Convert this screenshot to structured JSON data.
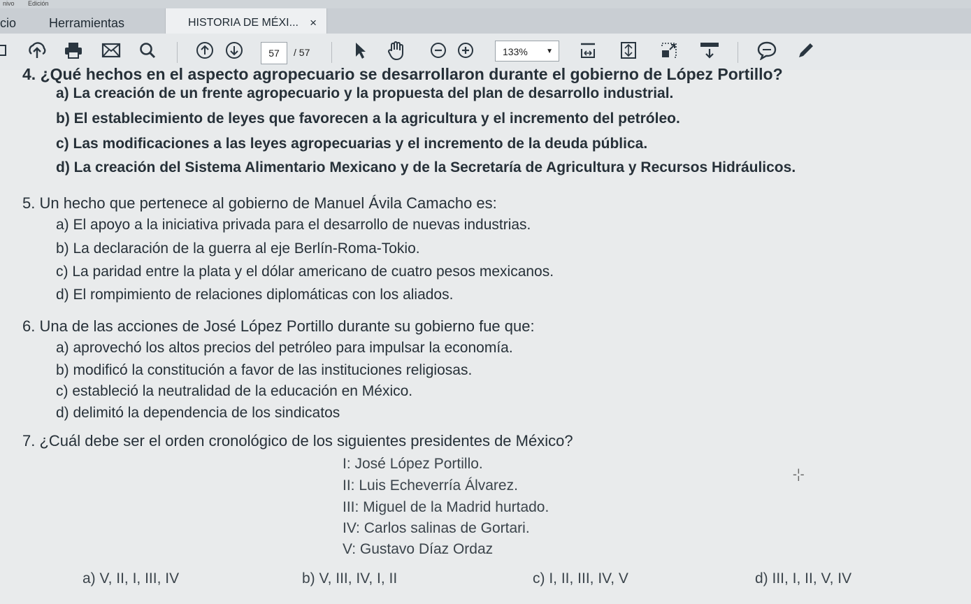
{
  "menubar": {
    "left": "nivo",
    "right": "Edición"
  },
  "tabs": {
    "inicio": "icio",
    "herramientas": "Herramientas",
    "document": "HISTORIA DE MÉXI...",
    "close": "×"
  },
  "toolbar": {
    "page_current": "57",
    "page_total": "/ 57",
    "zoom": "133%",
    "icons": [
      "sidebar-icon",
      "upload-icon",
      "print-icon",
      "email-icon",
      "search-icon",
      "page-up-icon",
      "page-down-icon",
      "select-arrow-icon",
      "hand-icon",
      "zoom-out-icon",
      "zoom-in-icon",
      "fit-width-icon",
      "fit-page-icon",
      "fullscreen-icon",
      "scroll-icon",
      "comment-icon",
      "pen-icon"
    ]
  },
  "questions": {
    "q4": {
      "stem": "4.  ¿Qué hechos en el aspecto agropecuario se desarrollaron durante el gobierno de López Portillo?",
      "a": "a) La creación de un frente agropecuario y la propuesta del plan de desarrollo industrial.",
      "b": "b) El establecimiento de leyes que favorecen a la agricultura y el incremento del petróleo.",
      "c": "c) Las modificaciones a las leyes agropecuarias y el incremento de la deuda pública.",
      "d": "d) La creación del Sistema Alimentario Mexicano y de la Secretaría de Agricultura y Recursos Hidráulicos."
    },
    "q5": {
      "stem": "5.  Un hecho que pertenece al gobierno de Manuel Ávila Camacho es:",
      "a": "a) El apoyo a la iniciativa privada para el desarrollo de nuevas industrias.",
      "b": "b) La declaración de la guerra al eje Berlín-Roma-Tokio.",
      "c": "c) La paridad entre la plata y el dólar americano de cuatro pesos mexicanos.",
      "d": "d) El rompimiento de relaciones diplomáticas con los aliados."
    },
    "q6": {
      "stem": "6.  Una de las acciones de José López Portillo durante su gobierno fue que:",
      "a": "a) aprovechó los altos precios del petróleo para impulsar la economía.",
      "b": "b) modificó la constitución a favor de las instituciones religiosas.",
      "c": "c) estableció la neutralidad de la educación en México.",
      "d": "d) delimitó la dependencia de los sindicatos"
    },
    "q7": {
      "stem": "7.  ¿Cuál debe ser el orden cronológico de los siguientes presidentes de México?",
      "list": [
        "I: José López Portillo.",
        "II: Luis Echeverría Álvarez.",
        "III: Miguel de la Madrid hurtado.",
        "IV: Carlos salinas de Gortari.",
        "V: Gustavo Díaz Ordaz"
      ],
      "a": "a) V, II, I, III, IV",
      "b": "b) V, III, IV, I, II",
      "c": "c) I, II, III, IV, V",
      "d": "d) III, I, II, V, IV"
    }
  }
}
